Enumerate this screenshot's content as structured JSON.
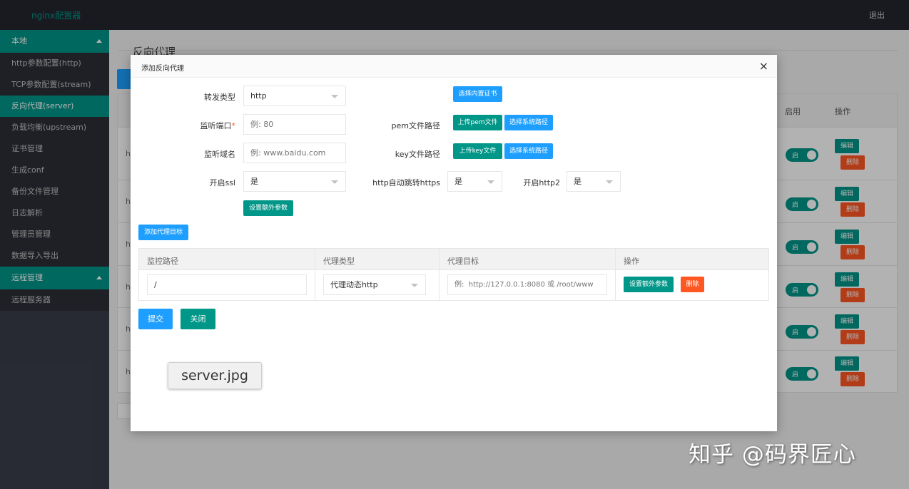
{
  "header": {
    "brand": "nginx配置器",
    "logout": "退出"
  },
  "sidebar": {
    "group_local": "本地",
    "items": [
      {
        "label": "http参数配置(http)",
        "active": false
      },
      {
        "label": "TCP参数配置(stream)",
        "active": false
      },
      {
        "label": "反向代理(server)",
        "active": true
      },
      {
        "label": "负载均衡(upstream)",
        "active": false
      },
      {
        "label": "证书管理",
        "active": false
      },
      {
        "label": "生成conf",
        "active": false
      },
      {
        "label": "备份文件管理",
        "active": false
      },
      {
        "label": "日志解析",
        "active": false
      },
      {
        "label": "管理员管理",
        "active": false
      },
      {
        "label": "数据导入导出",
        "active": false
      }
    ],
    "group_remote": "远程管理",
    "remote_items": [
      {
        "label": "远程服务器"
      }
    ]
  },
  "page": {
    "title": "反向代理",
    "table": {
      "col_enable": "启用",
      "col_ops": "操作",
      "rows": [
        {
          "h": "h",
          "switch": "启",
          "edit": "编辑",
          "del": "删除"
        },
        {
          "h": "h",
          "switch": "启",
          "edit": "编辑",
          "del": "删除"
        },
        {
          "h": "h",
          "switch": "启",
          "edit": "编辑",
          "del": "删除"
        },
        {
          "h": "h",
          "switch": "启",
          "edit": "编辑",
          "del": "删除"
        },
        {
          "h": "h",
          "switch": "启",
          "edit": "编辑",
          "del": "删除"
        },
        {
          "h": "h",
          "switch": "启",
          "edit": "编辑",
          "del": "删除"
        }
      ]
    }
  },
  "modal": {
    "title": "添加反向代理",
    "close": "×",
    "forward_type": {
      "label": "转发类型",
      "value": "http"
    },
    "listen_port": {
      "label": "监听端口",
      "required": "*",
      "placeholder": "例: 80"
    },
    "listen_domain": {
      "label": "监听域名",
      "placeholder": "例: www.baidu.com"
    },
    "ssl": {
      "label": "开启ssl",
      "value": "是"
    },
    "extra_params_btn": "设置额外参数",
    "select_builtin_cert_btn": "选择内置证书",
    "pem": {
      "label": "pem文件路径",
      "upload_btn": "上传pem文件",
      "select_btn": "选择系统路径"
    },
    "key": {
      "label": "key文件路径",
      "upload_btn": "上传key文件",
      "select_btn": "选择系统路径"
    },
    "http_redirect": {
      "label": "http自动跳转https",
      "value": "是"
    },
    "http2": {
      "label": "开启http2",
      "value": "是"
    },
    "add_target_btn": "添加代理目标",
    "proxy_table": {
      "headers": [
        "监控路径",
        "代理类型",
        "代理目标",
        "操作"
      ],
      "row": {
        "path": "/",
        "proxy_type": "代理动态http",
        "target_placeholder": "例:  http://127.0.0.1:8080 或 /root/www",
        "extra_btn": "设置额外参数",
        "del_btn": "删除"
      }
    },
    "submit_btn": "提交",
    "close_btn": "关闭"
  },
  "tooltip": "server.jpg",
  "watermark": "知乎 @码界匠心",
  "colors": {
    "primary": "#009688",
    "blue": "#1e9fff",
    "danger": "#ff5722",
    "sidebar": "#393d49",
    "header": "#23262e"
  }
}
